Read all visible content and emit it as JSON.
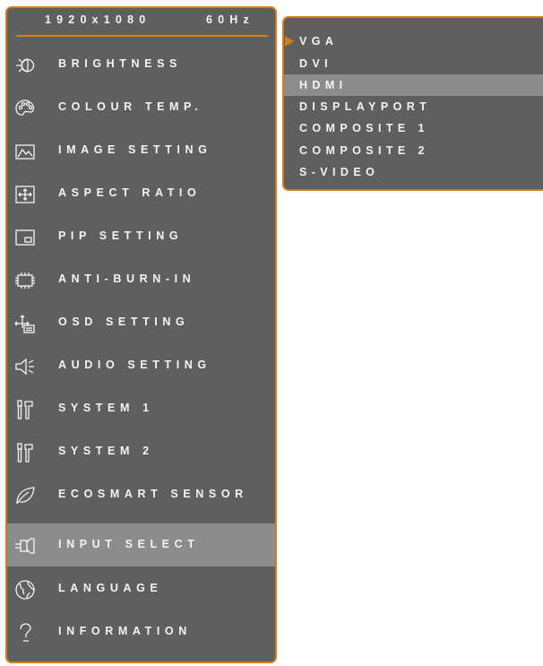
{
  "header": {
    "resolution": "1920x1080",
    "refresh": "60Hz"
  },
  "menu": {
    "items": [
      {
        "label": "BRIGHTNESS",
        "icon": "brightness-icon"
      },
      {
        "label": "COLOUR TEMP.",
        "icon": "palette-icon"
      },
      {
        "label": "IMAGE SETTING",
        "icon": "image-icon"
      },
      {
        "label": "ASPECT RATIO",
        "icon": "aspect-ratio-icon"
      },
      {
        "label": "PIP SETTING",
        "icon": "pip-icon"
      },
      {
        "label": "ANTI-BURN-IN",
        "icon": "chip-icon"
      },
      {
        "label": "OSD SETTING",
        "icon": "osd-icon"
      },
      {
        "label": "AUDIO SETTING",
        "icon": "speaker-icon"
      },
      {
        "label": "SYSTEM 1",
        "icon": "tools-icon"
      },
      {
        "label": "SYSTEM 2",
        "icon": "tools-icon"
      },
      {
        "label": "ECOSMART SENSOR",
        "icon": "leaf-icon"
      },
      {
        "label": "INPUT SELECT",
        "icon": "input-plug-icon"
      },
      {
        "label": "LANGUAGE",
        "icon": "globe-icon"
      },
      {
        "label": "INFORMATION",
        "icon": "question-icon"
      }
    ],
    "selected_index": 11
  },
  "submenu": {
    "items": [
      "VGA",
      "DVI",
      "HDMI",
      "DISPLAYPORT",
      "COMPOSITE 1",
      "COMPOSITE 2",
      "S-VIDEO"
    ],
    "current_index": 0,
    "highlighted_index": 2
  },
  "colors": {
    "panel": "#5f5f5f",
    "accent": "#d07f1b",
    "highlight": "#8c8c8c",
    "text": "#f4f4f4"
  }
}
